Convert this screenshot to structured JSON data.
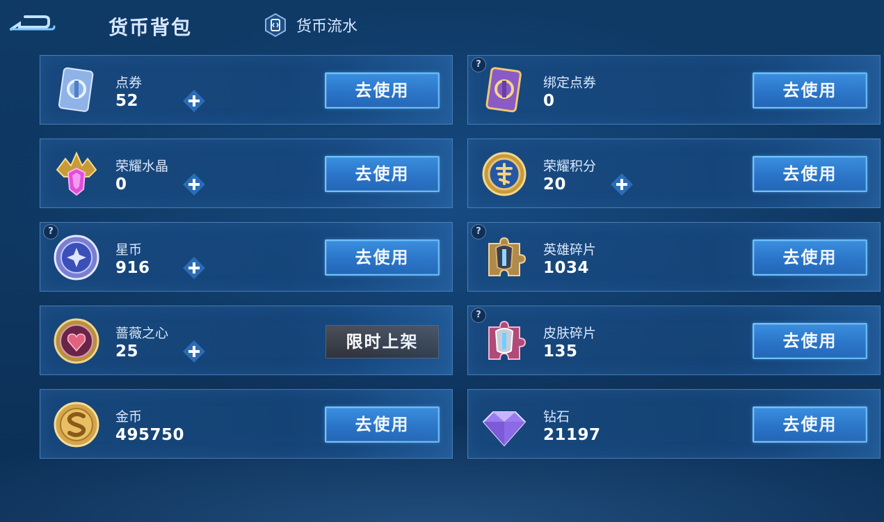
{
  "header": {
    "title": "货币背包",
    "flow_label": "货币流水"
  },
  "cards": {
    "dianquan": {
      "name": "点券",
      "value": "52",
      "action": "去使用",
      "has_plus": true,
      "help": false
    },
    "bangding": {
      "name": "绑定点券",
      "value": "0",
      "action": "去使用",
      "has_plus": false,
      "help": true
    },
    "shuijing": {
      "name": "荣耀水晶",
      "value": "0",
      "action": "去使用",
      "has_plus": true,
      "help": false
    },
    "jifen": {
      "name": "荣耀积分",
      "value": "20",
      "action": "去使用",
      "has_plus": true,
      "help": false
    },
    "xingbi": {
      "name": "星币",
      "value": "916",
      "action": "去使用",
      "has_plus": true,
      "help": true
    },
    "yingxiong": {
      "name": "英雄碎片",
      "value": "1034",
      "action": "去使用",
      "has_plus": false,
      "help": true
    },
    "qiangwei": {
      "name": "蔷薇之心",
      "value": "25",
      "action": "限时上架",
      "has_plus": true,
      "help": false
    },
    "pifu": {
      "name": "皮肤碎片",
      "value": "135",
      "action": "去使用",
      "has_plus": false,
      "help": true
    },
    "jinbi": {
      "name": "金币",
      "value": "495750",
      "action": "去使用",
      "has_plus": false,
      "help": false
    },
    "zuanshi": {
      "name": "钻石",
      "value": "21197",
      "action": "去使用",
      "has_plus": false,
      "help": false
    }
  },
  "help_glyph": "?",
  "icons": {
    "dianquan": "voucher-card-icon",
    "bangding": "bound-voucher-card-icon",
    "shuijing": "glory-crystal-icon",
    "jifen": "glory-points-icon",
    "xingbi": "star-coin-icon",
    "yingxiong": "hero-fragment-icon",
    "qiangwei": "rose-heart-icon",
    "pifu": "skin-fragment-icon",
    "jinbi": "gold-coin-icon",
    "zuanshi": "diamond-icon"
  },
  "colors": {
    "button_blue": "#2a74c8",
    "button_border": "#6fc3ff",
    "limited_gray": "#3b3f48",
    "card_border": "#6eaae6"
  }
}
